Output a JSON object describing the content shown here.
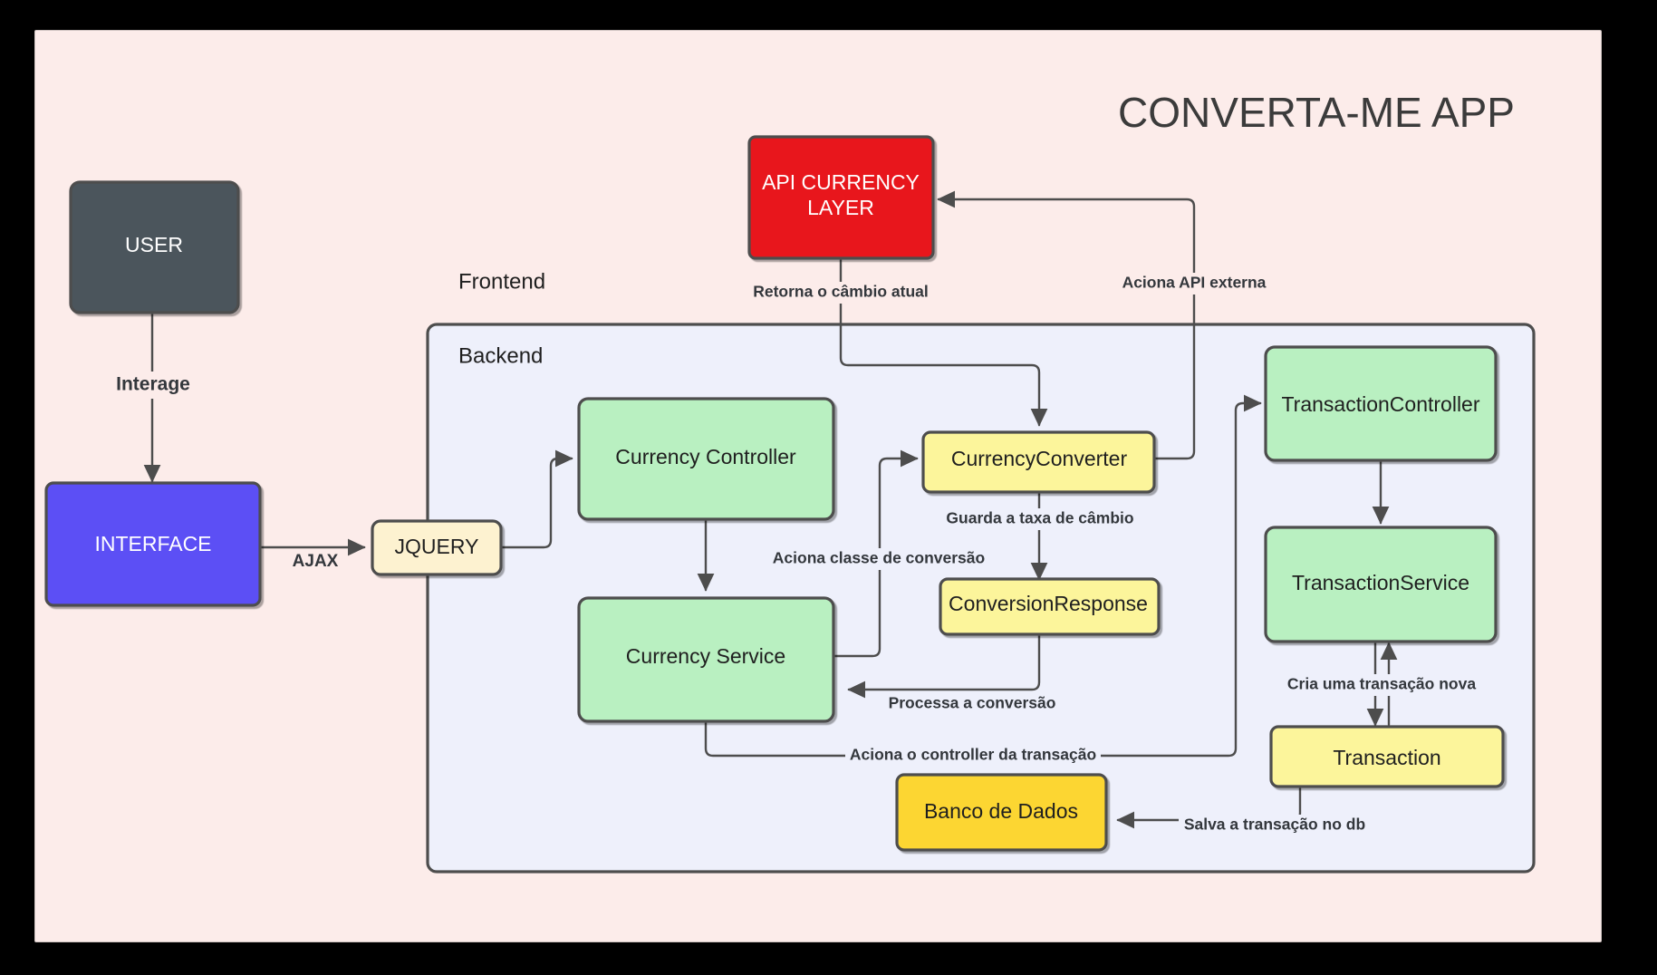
{
  "title": "CONVERTA-ME APP",
  "groups": [
    {
      "id": "frontend",
      "label": "Frontend"
    },
    {
      "id": "backend",
      "label": "Backend"
    }
  ],
  "nodes": [
    {
      "id": "user",
      "label": "USER",
      "fill": "#4c545c",
      "text_color": "#ffffff"
    },
    {
      "id": "interface",
      "label": "INTERFACE",
      "fill": "#5b4ff5",
      "text_color": "#ffffff"
    },
    {
      "id": "jquery",
      "label": "JQUERY",
      "fill": "#fdf2d0",
      "text_color": "#1f1f1f"
    },
    {
      "id": "api-currency-layer",
      "label_line1": "API CURRENCY",
      "label_line2": "LAYER",
      "fill": "#e8191a",
      "text_color": "#ffffff"
    },
    {
      "id": "currency-controller",
      "label": "Currency Controller",
      "fill": "#b9f0c1",
      "text_color": "#1f1f1f"
    },
    {
      "id": "currency-service",
      "label": "Currency Service",
      "fill": "#b9f0c1",
      "text_color": "#1f1f1f"
    },
    {
      "id": "currency-converter",
      "label": "CurrencyConverter",
      "fill": "#fcf59b",
      "text_color": "#1f1f1f"
    },
    {
      "id": "conversion-response",
      "label": "ConversionResponse",
      "fill": "#fcf59b",
      "text_color": "#1f1f1f"
    },
    {
      "id": "transaction-controller",
      "label": "TransactionController",
      "fill": "#b9f0c1",
      "text_color": "#1f1f1f"
    },
    {
      "id": "transaction-service",
      "label": "TransactionService",
      "fill": "#b9f0c1",
      "text_color": "#1f1f1f"
    },
    {
      "id": "transaction",
      "label": "Transaction",
      "fill": "#fcf59b",
      "text_color": "#1f1f1f"
    },
    {
      "id": "banco-de-dados",
      "label": "Banco de Dados",
      "fill": "#fcd632",
      "text_color": "#1f1f1f"
    }
  ],
  "edge_labels": {
    "interage": "Interage",
    "ajax": "AJAX",
    "retorna_cambio": "Retorna o câmbio atual",
    "aciona_api_externa": "Aciona API externa",
    "aciona_classe_conversao": "Aciona classe de conversão",
    "guarda_taxa": "Guarda a taxa de câmbio",
    "processa_conversao": "Processa a conversão",
    "aciona_controller_transacao": "Aciona o controller da transação",
    "cria_transacao_nova": "Cria uma transação nova",
    "salva_transacao": "Salva a transação no db"
  },
  "colors": {
    "canvas_bg": "#fcecea",
    "backend_bg": "#eef0fb",
    "edge_stroke": "#4d4d4d",
    "node_border": "#4d4d4d"
  }
}
